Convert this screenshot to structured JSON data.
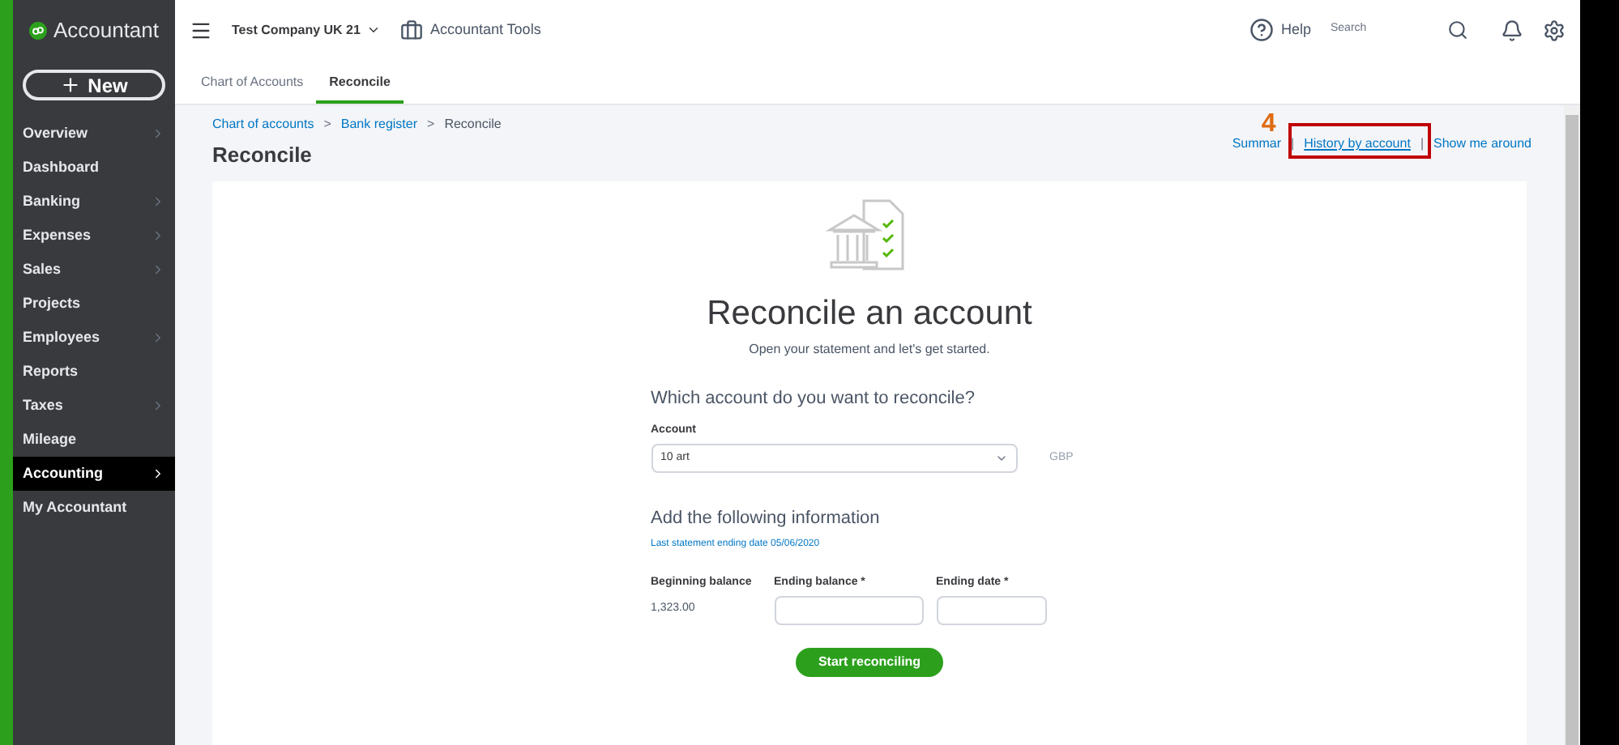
{
  "sidebar": {
    "brand": "Accountant",
    "new_button": "New",
    "items": [
      {
        "label": "Overview",
        "has_submenu": true,
        "selected": false
      },
      {
        "label": "Dashboard",
        "has_submenu": false,
        "selected": false
      },
      {
        "label": "Banking",
        "has_submenu": true,
        "selected": false
      },
      {
        "label": "Expenses",
        "has_submenu": true,
        "selected": false
      },
      {
        "label": "Sales",
        "has_submenu": true,
        "selected": false
      },
      {
        "label": "Projects",
        "has_submenu": false,
        "selected": false
      },
      {
        "label": "Employees",
        "has_submenu": true,
        "selected": false
      },
      {
        "label": "Reports",
        "has_submenu": false,
        "selected": false
      },
      {
        "label": "Taxes",
        "has_submenu": true,
        "selected": false
      },
      {
        "label": "Mileage",
        "has_submenu": false,
        "selected": false
      },
      {
        "label": "Accounting",
        "has_submenu": true,
        "selected": true
      },
      {
        "label": "My Accountant",
        "has_submenu": false,
        "selected": false
      }
    ]
  },
  "topbar": {
    "company": "Test Company UK 21",
    "tools": "Accountant Tools",
    "help": "Help",
    "search": {
      "placeholder": "Search"
    }
  },
  "tabs": [
    {
      "label": "Chart of Accounts",
      "selected": false
    },
    {
      "label": "Reconcile",
      "selected": true
    }
  ],
  "breadcrumb": [
    "Chart of accounts",
    "Bank register",
    "Reconcile"
  ],
  "breadcrumb_separator": ">",
  "link_separator": "|",
  "page_title": "Reconcile",
  "header_links": [
    "Summar",
    "History by account",
    "Show me around"
  ],
  "annotation": {
    "number": "4"
  },
  "card": {
    "title": "Reconcile an account",
    "subtitle": "Open your statement and let's get started.",
    "question": "Which account do you want to reconcile?",
    "account_label": "Account",
    "account_value": "10 art",
    "currency": "GBP",
    "info_title": "Add the following information",
    "last_statement": "Last statement ending date 05/06/2020",
    "beginning_label": "Beginning balance",
    "beginning_value": "1,323.00",
    "ending_balance_label": "Ending balance *",
    "ending_date_label": "Ending date *",
    "start_button": "Start reconciling"
  }
}
